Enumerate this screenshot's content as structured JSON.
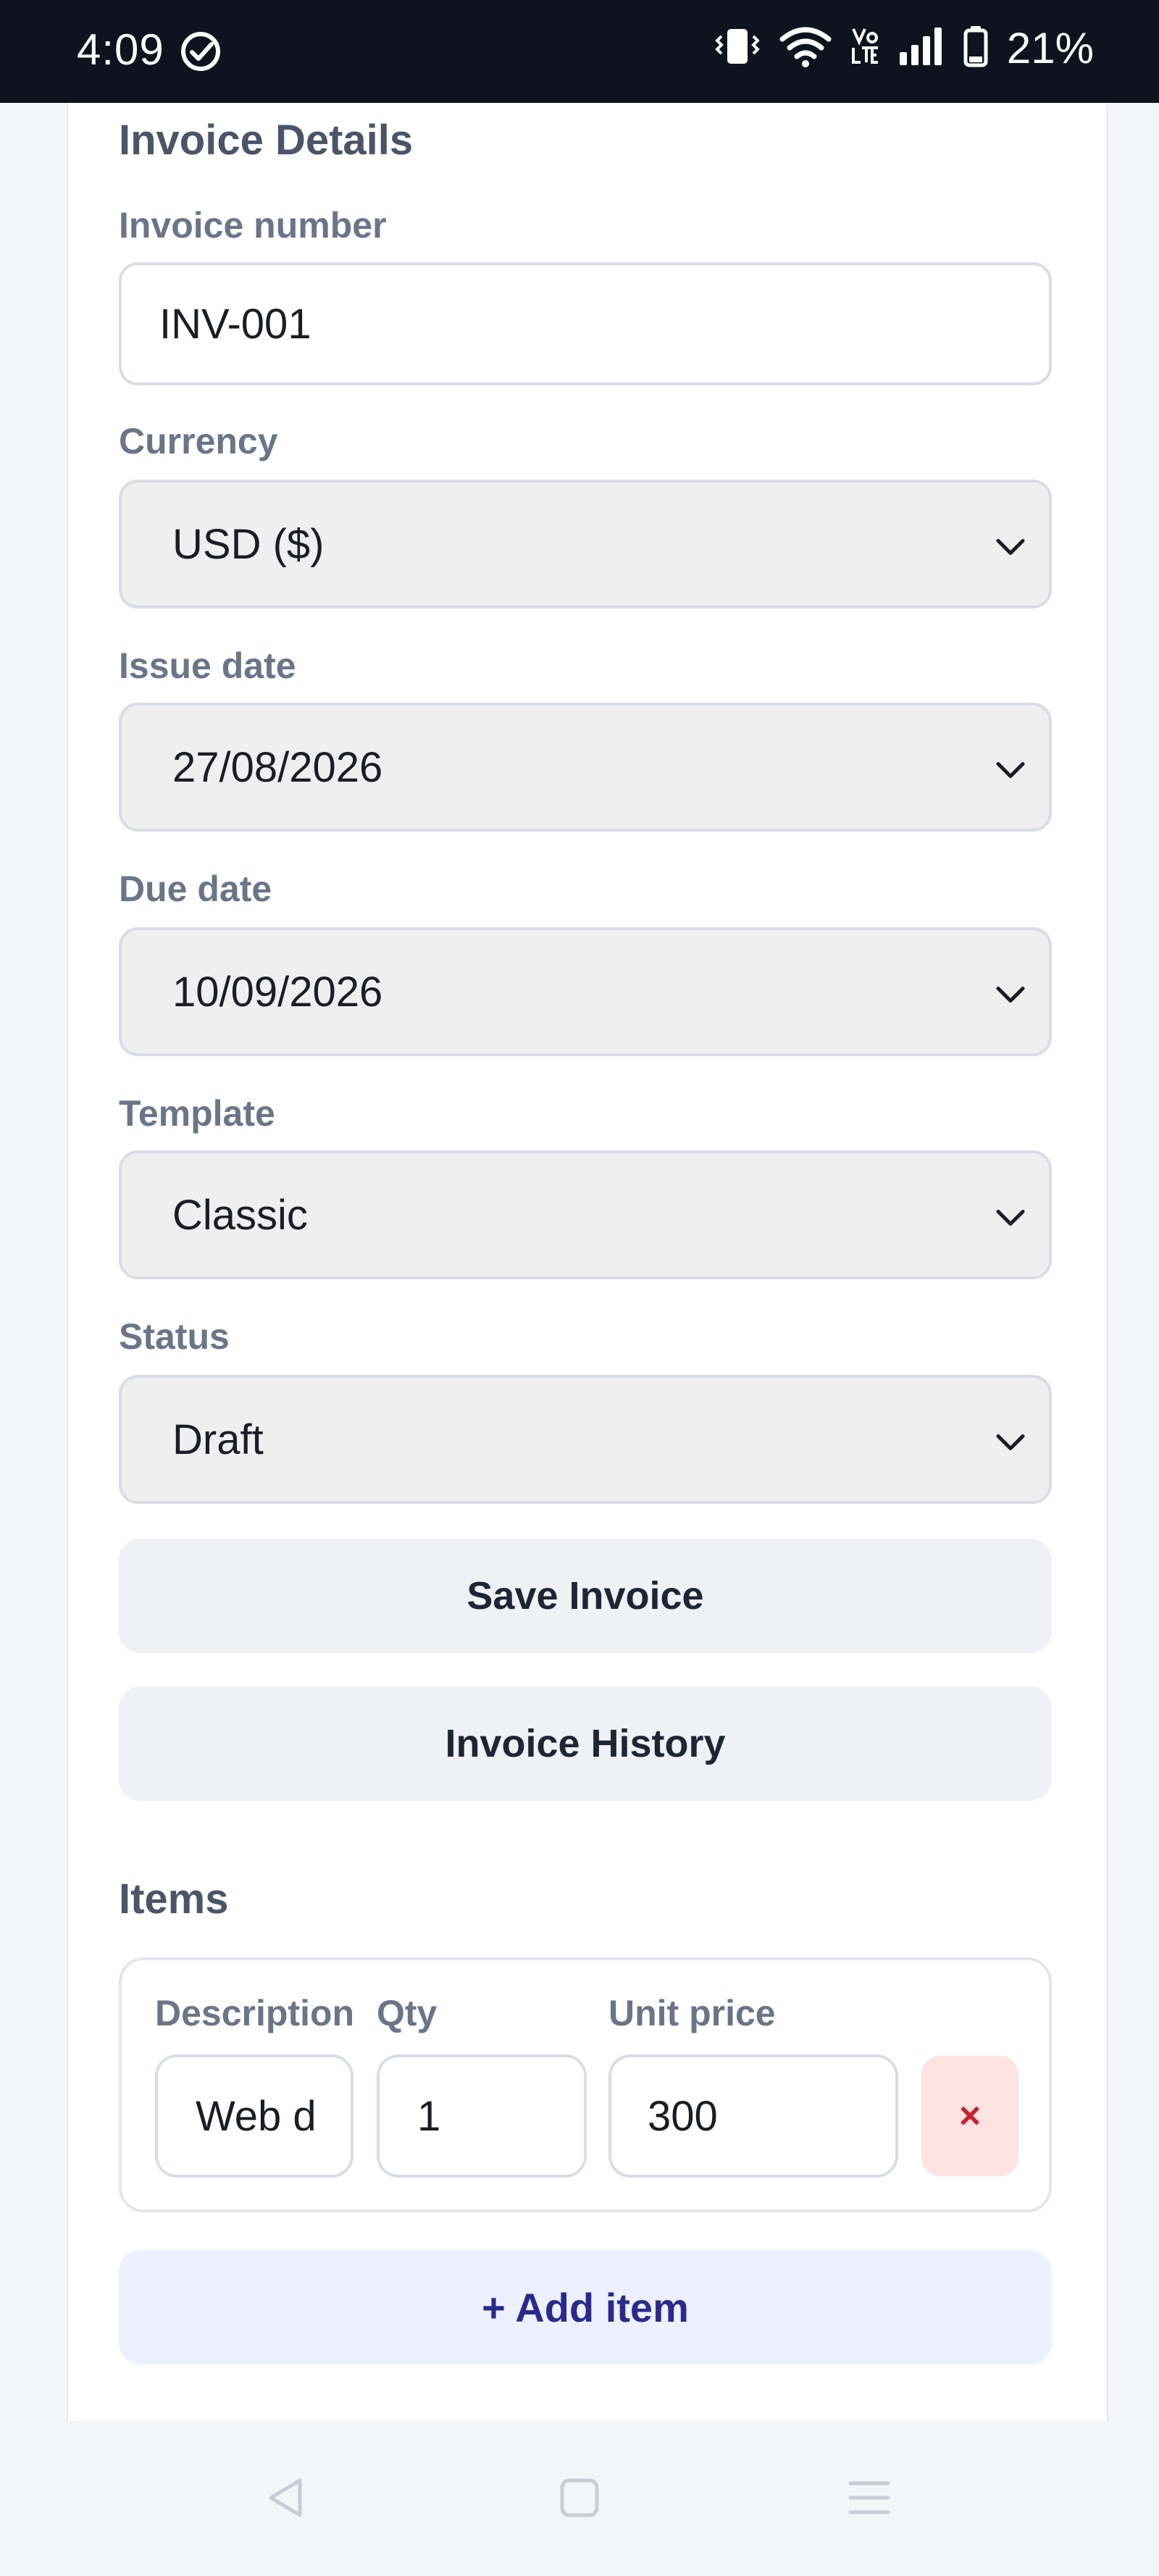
{
  "status_bar": {
    "time": "4:09",
    "battery_percent": "21%",
    "icons": [
      "check-circle-icon",
      "vibrate-icon",
      "wifi-icon",
      "volte-icon",
      "signal-icon",
      "battery-icon"
    ]
  },
  "invoice_details": {
    "title": "Invoice Details",
    "invoice_number": {
      "label": "Invoice number",
      "value": "INV-001"
    },
    "currency": {
      "label": "Currency",
      "value": "USD ($)"
    },
    "issue_date": {
      "label": "Issue date",
      "value": "27/08/2026"
    },
    "due_date": {
      "label": "Due date",
      "value": "10/09/2026"
    },
    "template": {
      "label": "Template",
      "value": "Classic"
    },
    "status": {
      "label": "Status",
      "value": "Draft"
    }
  },
  "actions": {
    "save_label": "Save Invoice",
    "history_label": "Invoice History"
  },
  "items": {
    "title": "Items",
    "columns": {
      "description": "Description",
      "qty": "Qty",
      "unit_price": "Unit price"
    },
    "rows": [
      {
        "description": "Web d",
        "qty": "1",
        "unit_price": "300",
        "remove_label": "×"
      }
    ],
    "add_label": "+ Add item"
  },
  "nav": {
    "icons": [
      "back-icon",
      "home-icon",
      "recents-icon"
    ]
  },
  "colors": {
    "status_bar_bg": "#0e131d",
    "page_bg": "#f4f5f9",
    "label_text": "#6b7588",
    "remove_bg": "#fde2e2",
    "remove_fg": "#c8242c",
    "add_bg": "#eef1fd",
    "add_fg": "#2a2a8e"
  }
}
